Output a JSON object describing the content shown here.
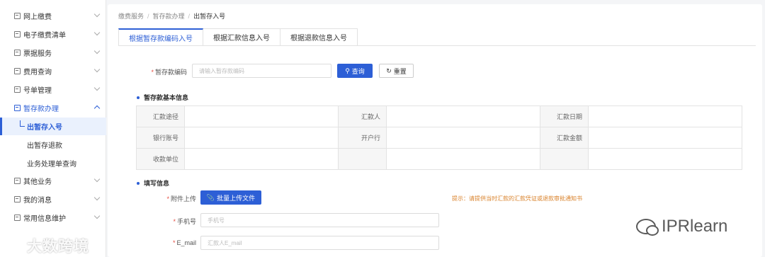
{
  "sidebar": {
    "items": [
      {
        "label": "网上缴费",
        "expanded": false
      },
      {
        "label": "电子缴费清单",
        "expanded": false
      },
      {
        "label": "票据服务",
        "expanded": false
      },
      {
        "label": "费用查询",
        "expanded": false
      },
      {
        "label": "号单管理",
        "expanded": false
      },
      {
        "label": "暂存款办理",
        "expanded": true,
        "children": [
          {
            "label": "出暂存入号",
            "current": true
          },
          {
            "label": "出暂存退款"
          },
          {
            "label": "业务处理单查询"
          }
        ]
      },
      {
        "label": "其他业务",
        "expanded": false
      },
      {
        "label": "我的消息",
        "expanded": false
      },
      {
        "label": "常用信息维护",
        "expanded": false
      }
    ]
  },
  "breadcrumb": [
    "缴费服务",
    "暂存款办理",
    "出暂存入号"
  ],
  "tabs": [
    {
      "label": "根据暂存款编码入号",
      "active": true
    },
    {
      "label": "根据汇款信息入号"
    },
    {
      "label": "根据退款信息入号"
    }
  ],
  "search": {
    "label": "暂存款编码",
    "placeholder": "请输入暂存款编码",
    "query_button": "查询",
    "reset_button": "重置"
  },
  "basic_info": {
    "title": "暂存款基本信息",
    "rows": [
      [
        {
          "key": "汇款途径",
          "value": ""
        },
        {
          "key": "汇款人",
          "value": ""
        },
        {
          "key": "汇款日期",
          "value": ""
        }
      ],
      [
        {
          "key": "银行账号",
          "value": ""
        },
        {
          "key": "开户行",
          "value": ""
        },
        {
          "key": "汇款金额",
          "value": ""
        }
      ],
      [
        {
          "key": "收款单位",
          "value": ""
        },
        {
          "key": "",
          "value": ""
        },
        {
          "key": "",
          "value": ""
        }
      ]
    ]
  },
  "fill_info": {
    "title": "填写信息",
    "attachment_label": "附件上传",
    "upload_button": "批量上传文件",
    "hint": "提示：请提供当时汇款的汇款凭证或退款审批通知书",
    "phone_label": "手机号",
    "phone_placeholder": "手机号",
    "email_label": "E_mail",
    "email_placeholder": "汇款人E_mail"
  },
  "watermark_left": "大数跨境",
  "watermark_right": "IPRlearn",
  "colors": {
    "accent": "#2d5fd6",
    "hint": "#d9822b",
    "required": "#e54d42"
  }
}
